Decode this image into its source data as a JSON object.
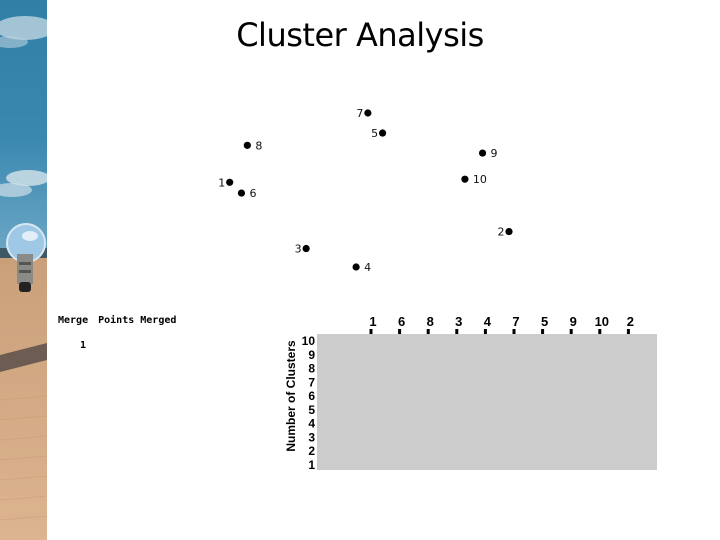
{
  "title": "Cluster Analysis",
  "sidebar_image": {
    "description": "decorative photo: blue sky with clouds, glass light bulb standing on desert sand"
  },
  "merge_table": {
    "headers": [
      "Merge",
      "Points Merged"
    ],
    "rows": [
      {
        "merge": "1",
        "points": ""
      }
    ]
  },
  "chart_data": [
    {
      "type": "scatter",
      "title": "",
      "xlabel": "",
      "ylabel": "",
      "grid": false,
      "xlim": [
        0,
        100
      ],
      "ylim": [
        0,
        100
      ],
      "points": [
        {
          "label": "1",
          "x": 5,
          "y": 55,
          "label_side": "left"
        },
        {
          "label": "2",
          "x": 100,
          "y": 23,
          "label_side": "left"
        },
        {
          "label": "3",
          "x": 31,
          "y": 12,
          "label_side": "left"
        },
        {
          "label": "4",
          "x": 48,
          "y": 0,
          "label_side": "right"
        },
        {
          "label": "5",
          "x": 57,
          "y": 87,
          "label_side": "left"
        },
        {
          "label": "6",
          "x": 9,
          "y": 48,
          "label_side": "right"
        },
        {
          "label": "7",
          "x": 52,
          "y": 100,
          "label_side": "left"
        },
        {
          "label": "8",
          "x": 11,
          "y": 79,
          "label_side": "right"
        },
        {
          "label": "9",
          "x": 91,
          "y": 74,
          "label_side": "right"
        },
        {
          "label": "10",
          "x": 85,
          "y": 57,
          "label_side": "right"
        }
      ]
    },
    {
      "type": "dendrogram",
      "title": "",
      "ylabel": "Number of Clusters",
      "leaf_order": [
        "1",
        "6",
        "8",
        "3",
        "4",
        "7",
        "5",
        "9",
        "10",
        "2"
      ],
      "y_ticks": [
        "10",
        "9",
        "8",
        "7",
        "6",
        "5",
        "4",
        "3",
        "2",
        "1"
      ],
      "ylim": [
        1,
        10
      ],
      "merges": [],
      "panel_color": "#cccccc"
    }
  ]
}
